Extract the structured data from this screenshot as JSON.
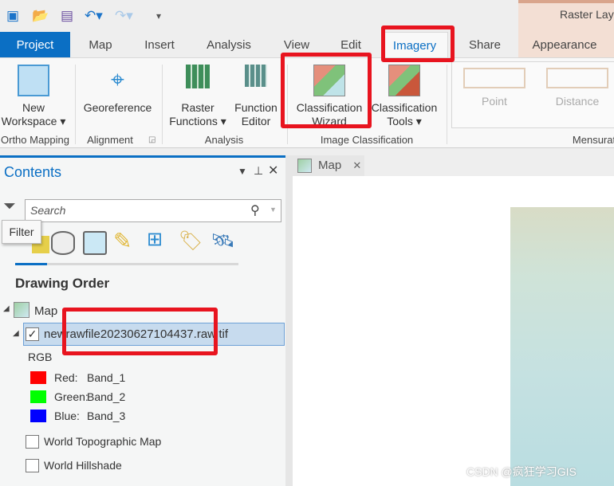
{
  "contextual_tab_title": "Raster Lay",
  "quick_access": [
    "new-project-icon",
    "open-icon",
    "save-icon",
    "undo-icon",
    "redo-icon",
    "customize-icon"
  ],
  "tabs": [
    "Project",
    "Map",
    "Insert",
    "Analysis",
    "View",
    "Edit",
    "Imagery",
    "Share",
    "Appearance"
  ],
  "ribbon": {
    "buttons": {
      "new_workspace": [
        "New",
        "Workspace ▾"
      ],
      "georeference": "Georeference",
      "raster_functions": [
        "Raster",
        "Functions ▾"
      ],
      "function_editor": [
        "Function",
        "Editor"
      ],
      "classification_wizard": [
        "Classification",
        "Wizard"
      ],
      "classification_tools": [
        "Classification",
        "Tools ▾"
      ],
      "point": "Point",
      "distance": "Distance"
    },
    "groups": [
      "Ortho Mapping",
      "Alignment",
      "Analysis",
      "Image Classification",
      "Mensurat"
    ]
  },
  "contents": {
    "title": "Contents",
    "search_placeholder": "Search",
    "tooltip": "Filter",
    "heading": "Drawing Order",
    "map": "Map",
    "layer": "newrawfile20230627104437.raw.tif",
    "renderer": "RGB",
    "bands": [
      {
        "label": "Red:",
        "band": "Band_1",
        "color": "#ff0000"
      },
      {
        "label": "Green:",
        "band": "Band_2",
        "color": "#00ff00"
      },
      {
        "label": "Blue:",
        "band": "Band_3",
        "color": "#0000ff"
      }
    ],
    "basemaps": [
      "World Topographic Map",
      "World Hillshade"
    ]
  },
  "map_view": {
    "tab": "Map"
  },
  "watermark": "CSDN @疯狂学习GIS"
}
